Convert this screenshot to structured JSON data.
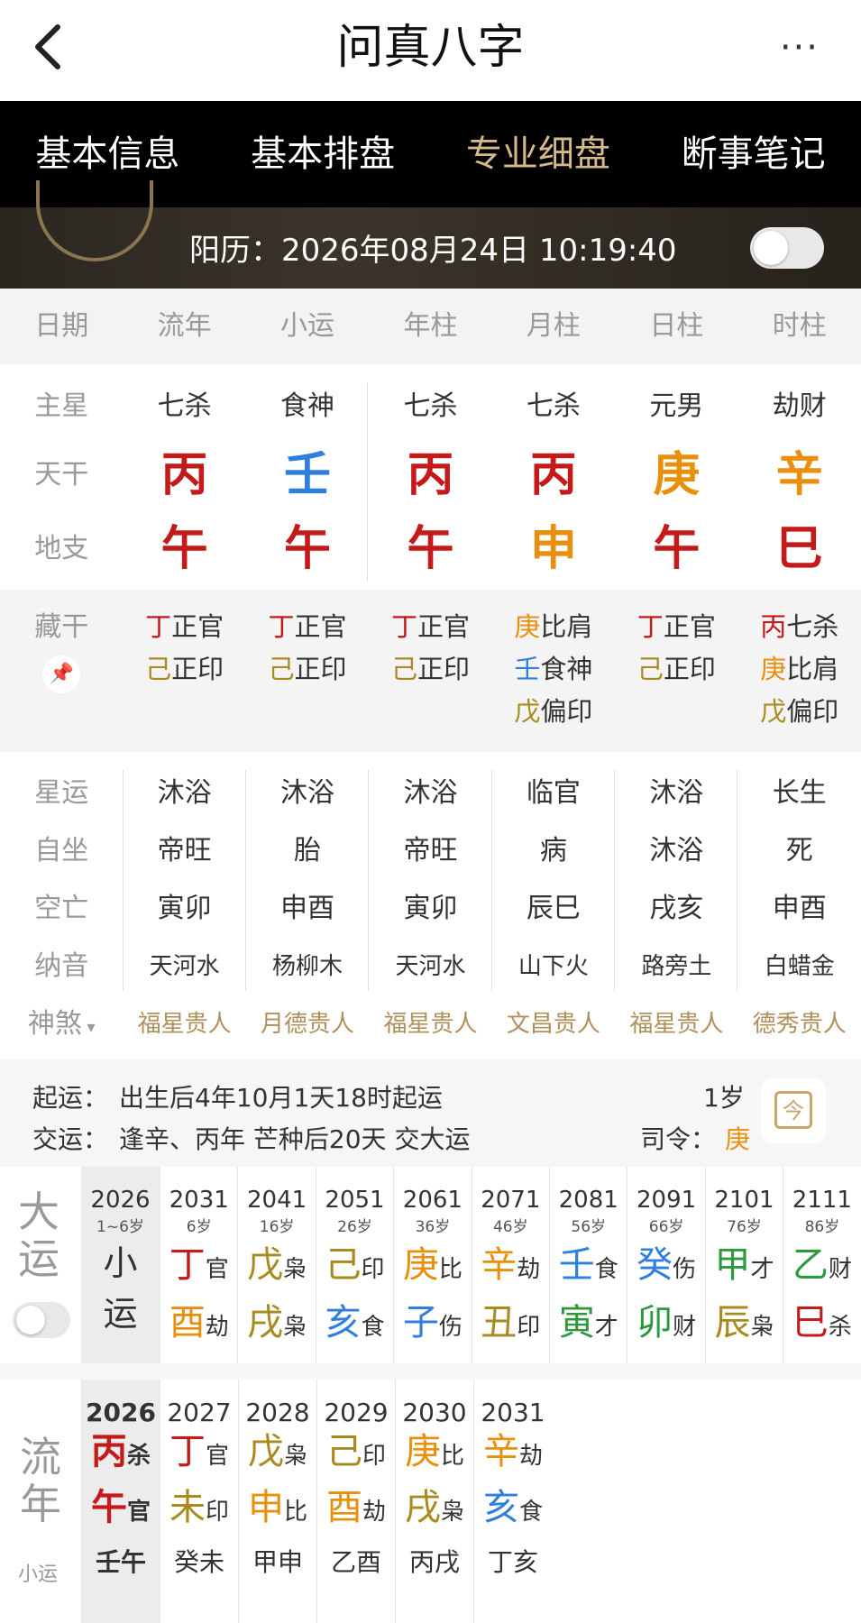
{
  "header": {
    "title": "问真八字",
    "back_icon": "chevron-left-icon",
    "more_icon": "more-icon",
    "more_glyph": "···"
  },
  "tabs": [
    "基本信息",
    "基本排盘",
    "专业细盘",
    "断事笔记"
  ],
  "banner": {
    "date": "阳历：2026年08月24日 10:19:40"
  },
  "columns": [
    "日期",
    "流年",
    "小运",
    "年柱",
    "月柱",
    "日柱",
    "时柱"
  ],
  "pillars": {
    "zhuxing_label": "主星",
    "tiangan_label": "天干",
    "dizhi_label": "地支",
    "zhuxing": [
      "七杀",
      "食神",
      "七杀",
      "七杀",
      "元男",
      "劫财"
    ],
    "tiangan": [
      "丙",
      "壬",
      "丙",
      "丙",
      "庚",
      "辛"
    ],
    "dizhi": [
      "午",
      "午",
      "午",
      "申",
      "午",
      "巳"
    ]
  },
  "canggan": {
    "label": "藏干",
    "cols": [
      [
        [
          "丁",
          "正官"
        ],
        [
          "己",
          "正印"
        ]
      ],
      [
        [
          "丁",
          "正官"
        ],
        [
          "己",
          "正印"
        ]
      ],
      [
        [
          "丁",
          "正官"
        ],
        [
          "己",
          "正印"
        ]
      ],
      [
        [
          "庚",
          "比肩"
        ],
        [
          "壬",
          "食神"
        ],
        [
          "戊",
          "偏印"
        ]
      ],
      [
        [
          "丁",
          "正官"
        ],
        [
          "己",
          "正印"
        ]
      ],
      [
        [
          "丙",
          "七杀"
        ],
        [
          "庚",
          "比肩"
        ],
        [
          "戊",
          "偏印"
        ]
      ]
    ]
  },
  "detail": {
    "rows": [
      {
        "label": "星运",
        "vals": [
          "沐浴",
          "沐浴",
          "沐浴",
          "临官",
          "沐浴",
          "长生"
        ]
      },
      {
        "label": "自坐",
        "vals": [
          "帝旺",
          "胎",
          "帝旺",
          "病",
          "沐浴",
          "死"
        ]
      },
      {
        "label": "空亡",
        "vals": [
          "寅卯",
          "申酉",
          "寅卯",
          "辰巳",
          "戌亥",
          "申酉"
        ]
      },
      {
        "label": "纳音",
        "vals": [
          "天河水",
          "杨柳木",
          "天河水",
          "山下火",
          "路旁土",
          "白蜡金"
        ]
      }
    ],
    "shensha_label": "神煞",
    "shensha": [
      "福星贵人",
      "月德贵人",
      "福星贵人",
      "文昌贵人",
      "福星贵人",
      "德秀贵人"
    ]
  },
  "qiyun": {
    "line1_label": "起运：",
    "line1": "出生后4年10月1天18时起运",
    "line2_label": "交运：",
    "line2": "逢辛、丙年 芒种后20天 交大运",
    "age": "1岁",
    "siling_label": "司令：",
    "siling": "庚",
    "calendar_icon": "calendar-icon",
    "calendar_glyph": "今"
  },
  "dayun": {
    "label1": "大",
    "label2": "运",
    "first": {
      "year": "2026",
      "age": "1~6岁",
      "a": "小",
      "b": "运"
    },
    "items": [
      {
        "year": "2031",
        "age": "6岁",
        "g": "丁",
        "gs": "官",
        "z": "酉",
        "zs": "劫"
      },
      {
        "year": "2041",
        "age": "16岁",
        "g": "戊",
        "gs": "枭",
        "z": "戌",
        "zs": "枭"
      },
      {
        "year": "2051",
        "age": "26岁",
        "g": "己",
        "gs": "印",
        "z": "亥",
        "zs": "食"
      },
      {
        "year": "2061",
        "age": "36岁",
        "g": "庚",
        "gs": "比",
        "z": "子",
        "zs": "伤"
      },
      {
        "year": "2071",
        "age": "46岁",
        "g": "辛",
        "gs": "劫",
        "z": "丑",
        "zs": "印"
      },
      {
        "year": "2081",
        "age": "56岁",
        "g": "壬",
        "gs": "食",
        "z": "寅",
        "zs": "才"
      },
      {
        "year": "2091",
        "age": "66岁",
        "g": "癸",
        "gs": "伤",
        "z": "卯",
        "zs": "财"
      },
      {
        "year": "2101",
        "age": "76岁",
        "g": "甲",
        "gs": "才",
        "z": "辰",
        "zs": "枭"
      },
      {
        "year": "2111",
        "age": "86岁",
        "g": "乙",
        "gs": "财",
        "z": "巳",
        "zs": "杀"
      }
    ]
  },
  "liunian": {
    "label1": "流",
    "label2": "年",
    "sub": "小运",
    "items": [
      {
        "year": "2026",
        "g": "丙",
        "gs": "杀",
        "z": "午",
        "zs": "官",
        "xy": "壬午"
      },
      {
        "year": "2027",
        "g": "丁",
        "gs": "官",
        "z": "未",
        "zs": "印",
        "xy": "癸未"
      },
      {
        "year": "2028",
        "g": "戊",
        "gs": "枭",
        "z": "申",
        "zs": "比",
        "xy": "甲申"
      },
      {
        "year": "2029",
        "g": "己",
        "gs": "印",
        "z": "酉",
        "zs": "劫",
        "xy": "乙酉"
      },
      {
        "year": "2030",
        "g": "庚",
        "gs": "比",
        "z": "戌",
        "zs": "枭",
        "xy": "丙戌"
      },
      {
        "year": "2031",
        "g": "辛",
        "gs": "劫",
        "z": "亥",
        "zs": "食",
        "xy": "丁亥"
      }
    ]
  },
  "colors": {
    "accent": "#d5b98b",
    "red": "#c41a1a",
    "blue": "#2f7fdc",
    "orange": "#e8900d",
    "green": "#2b9a3c",
    "gold": "#a88a1e"
  }
}
